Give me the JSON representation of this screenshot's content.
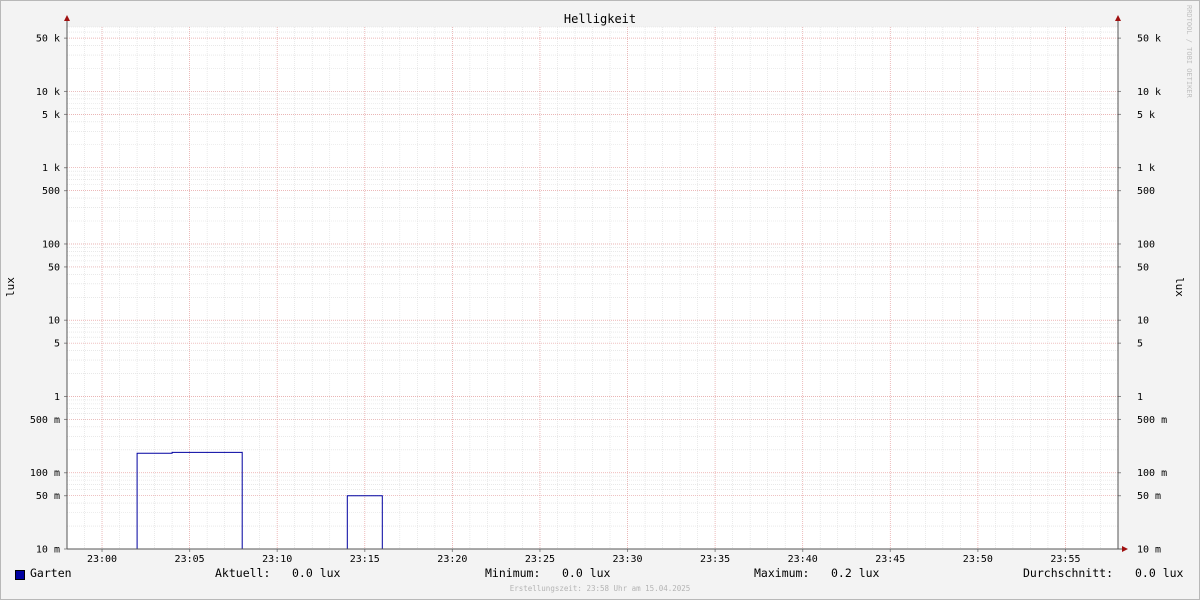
{
  "chart_data": {
    "type": "line",
    "title": "Helligkeit",
    "ylabel": "lux",
    "ylabel_right": "lux",
    "y_scale": "log",
    "ylim": [
      0.01,
      70000
    ],
    "y_ticks": [
      {
        "value": 50000,
        "label": "50 k"
      },
      {
        "value": 10000,
        "label": "10 k"
      },
      {
        "value": 5000,
        "label": "5 k"
      },
      {
        "value": 1000,
        "label": "1 k"
      },
      {
        "value": 500,
        "label": "500"
      },
      {
        "value": 100,
        "label": "100"
      },
      {
        "value": 50,
        "label": "50"
      },
      {
        "value": 10,
        "label": "10"
      },
      {
        "value": 5,
        "label": "5"
      },
      {
        "value": 1,
        "label": "1"
      },
      {
        "value": 0.5,
        "label": "500 m"
      },
      {
        "value": 0.1,
        "label": "100 m"
      },
      {
        "value": 0.05,
        "label": "50 m"
      },
      {
        "value": 0.01,
        "label": "10 m"
      }
    ],
    "x_ticks": [
      "23:00",
      "23:05",
      "23:10",
      "23:15",
      "23:20",
      "23:25",
      "23:30",
      "23:35",
      "23:40",
      "23:45",
      "23:50",
      "23:55"
    ],
    "xlim": [
      "22:58",
      "23:58"
    ],
    "grid": true,
    "series": [
      {
        "name": "Garten",
        "color": "#0000a0",
        "step": true,
        "points": [
          {
            "x": "22:58",
            "y": 0.01
          },
          {
            "x": "23:02",
            "y": 0.01
          },
          {
            "x": "23:02",
            "y": 0.18
          },
          {
            "x": "23:04",
            "y": 0.18
          },
          {
            "x": "23:04",
            "y": 0.185
          },
          {
            "x": "23:08",
            "y": 0.185
          },
          {
            "x": "23:08",
            "y": 0.01
          },
          {
            "x": "23:14",
            "y": 0.01
          },
          {
            "x": "23:14",
            "y": 0.05
          },
          {
            "x": "23:16",
            "y": 0.05
          },
          {
            "x": "23:16",
            "y": 0.01
          },
          {
            "x": "23:58",
            "y": 0.01
          }
        ]
      }
    ]
  },
  "legend": {
    "series_name": "Garten",
    "current_label": "Aktuell:",
    "current_value": "0.0 lux",
    "min_label": "Minimum:",
    "min_value": "0.0 lux",
    "max_label": "Maximum:",
    "max_value": "0.2 lux",
    "avg_label": "Durchschnitt:",
    "avg_value": "0.0 lux"
  },
  "watermark": "RRDTOOL / TOBI OETIKER",
  "footer": "Erstellungszeit: 23:58 Uhr am 15.04.2025"
}
